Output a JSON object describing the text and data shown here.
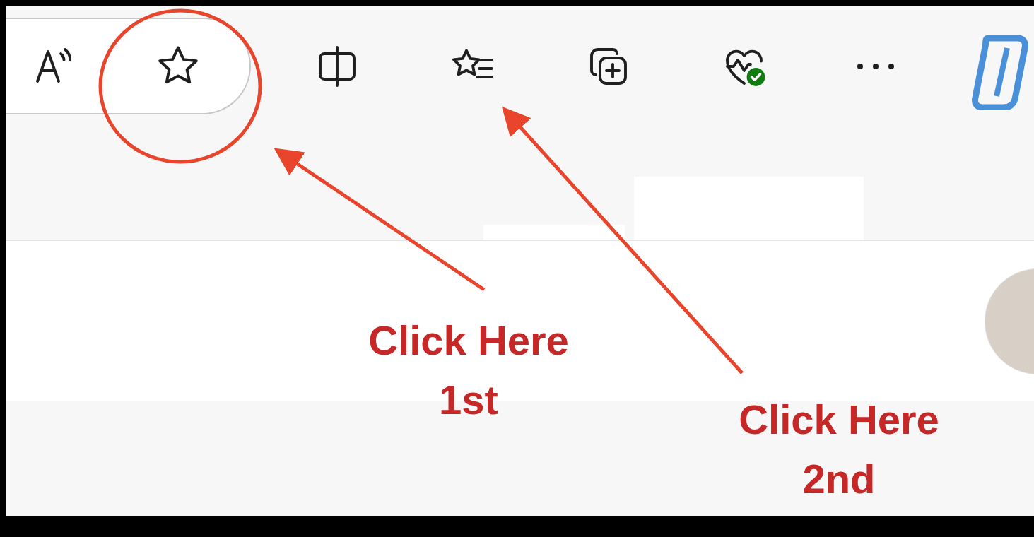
{
  "annotations": [
    {
      "lines": [
        "Click Here",
        "1st"
      ]
    },
    {
      "lines": [
        "Click Here",
        "2nd"
      ]
    }
  ]
}
